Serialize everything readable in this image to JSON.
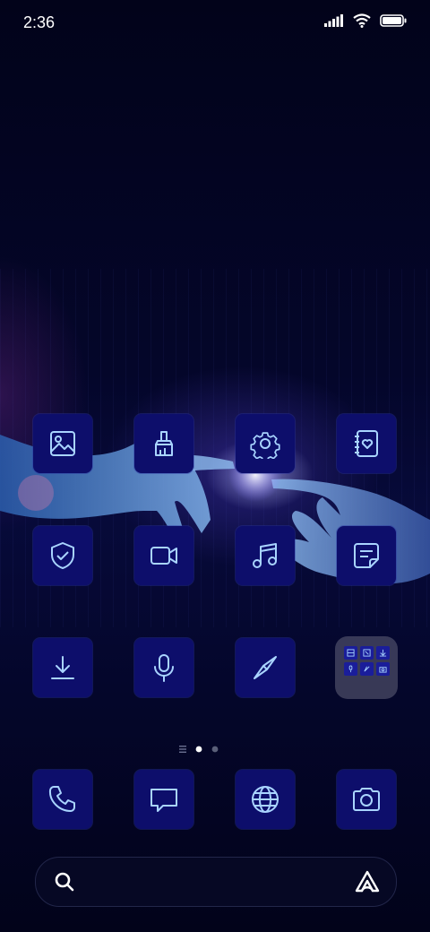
{
  "status_bar": {
    "time": "2:36",
    "icons": [
      "signal-icon",
      "wifi-icon",
      "battery-icon"
    ]
  },
  "apps": [
    {
      "name": "gallery",
      "icon": "image-icon"
    },
    {
      "name": "cleaner",
      "icon": "brush-icon"
    },
    {
      "name": "settings",
      "icon": "gear-icon"
    },
    {
      "name": "notes-book",
      "icon": "heart-notebook-icon"
    },
    {
      "name": "security",
      "icon": "shield-check-icon"
    },
    {
      "name": "video",
      "icon": "video-camera-icon"
    },
    {
      "name": "music",
      "icon": "music-note-icon"
    },
    {
      "name": "notes",
      "icon": "note-icon"
    },
    {
      "name": "downloads",
      "icon": "download-icon"
    },
    {
      "name": "recorder",
      "icon": "microphone-icon"
    },
    {
      "name": "compass",
      "icon": "compass-icon"
    },
    {
      "name": "folder",
      "icon": "app-folder-icon"
    }
  ],
  "dock": [
    {
      "name": "phone",
      "icon": "phone-icon"
    },
    {
      "name": "messages",
      "icon": "message-icon"
    },
    {
      "name": "browser",
      "icon": "globe-icon"
    },
    {
      "name": "camera",
      "icon": "camera-icon"
    }
  ],
  "pager": {
    "pages": 2,
    "current": 1
  },
  "search": {
    "icons": [
      "search-icon",
      "assistant-icon"
    ]
  },
  "colors": {
    "tile": "#0d0e6b",
    "glyph": "#a9d4ff",
    "background": "#03041a"
  }
}
